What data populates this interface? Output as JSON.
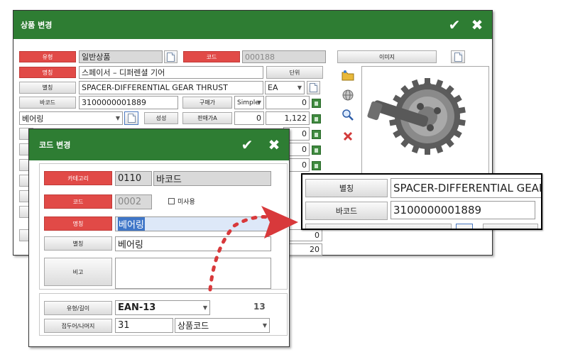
{
  "product_window": {
    "title": "상품 변경",
    "fields": {
      "type_label": "유형",
      "type_value": "일반상품",
      "code_label": "코드",
      "code_value": "000188",
      "name_label": "명칭",
      "name_value": "스페이서 – 디퍼렌셜 기어",
      "unit_label": "단위",
      "alias_label": "별칭",
      "alias_value": "SPACER-DIFFERENTIAL GEAR THRUST",
      "unit_value": "EA",
      "barcode_label": "바코드",
      "barcode_value": "3100000001889",
      "purchase_label": "구매가",
      "purchase_mode": "Simple",
      "purchase_value": "0",
      "category_value": "베어링",
      "property_label": "성성",
      "sale_label": "판매가A",
      "sale_value1": "0",
      "sale_value2": "1,122",
      "extra_values": [
        "0",
        "0",
        "0"
      ],
      "bottom_values": [
        "0",
        "20"
      ],
      "image_label": "이미지"
    }
  },
  "code_dialog": {
    "title": "코드 변경",
    "category_label": "카테고리",
    "category_code": "0110",
    "category_name": "바코드",
    "code_label": "코드",
    "code_value": "0002",
    "unused_label": "미사용",
    "name_label": "명칭",
    "name_value": "베어링",
    "alias_label": "별칭",
    "alias_value": "베어링",
    "note_label": "비고",
    "note_value": "",
    "type_length_label": "유형/길이",
    "type_value": "EAN-13",
    "length_value": "13",
    "prefix_label": "접두어/나머지",
    "prefix_value": "31",
    "rest_value": "상품코드"
  },
  "zoom_callout": {
    "alias_label": "별칭",
    "alias_value": "SPACER-DIFFERENTIAL GEAR",
    "barcode_label": "바코드",
    "barcode_value": "3100000001889"
  },
  "colors": {
    "title_green": "#2e7d33",
    "label_red": "#e14a47",
    "annotation_red": "#d8393b"
  },
  "icons": [
    "check-icon",
    "close-icon",
    "document-icon",
    "calculator-icon",
    "folder-icon",
    "globe-icon",
    "magnify-icon",
    "delete-icon",
    "gear-image"
  ]
}
